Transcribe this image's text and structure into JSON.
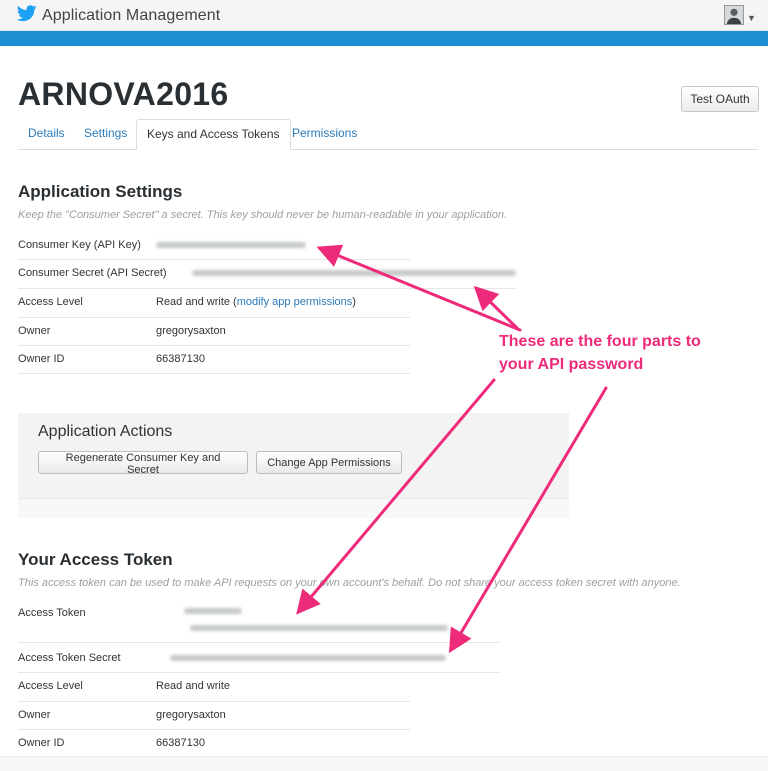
{
  "topbar": {
    "brand_title": "Application Management"
  },
  "header": {
    "app_name": "ARNOVA2016",
    "test_oauth_label": "Test OAuth"
  },
  "tabs": [
    {
      "label": "Details",
      "active": false
    },
    {
      "label": "Settings",
      "active": false
    },
    {
      "label": "Keys and Access Tokens",
      "active": true
    },
    {
      "label": "Permissions",
      "active": false
    }
  ],
  "application_settings": {
    "title": "Application Settings",
    "description": "Keep the \"Consumer Secret\" a secret. This key should never be human-readable in your application.",
    "rows": [
      {
        "label": "Consumer Key (API Key)",
        "value": ""
      },
      {
        "label": "Consumer Secret (API Secret)",
        "value": ""
      },
      {
        "label": "Access Level",
        "value": "Read and write (",
        "link": "modify app permissions",
        "suffix": ")"
      },
      {
        "label": "Owner",
        "value": "gregorysaxton"
      },
      {
        "label": "Owner ID",
        "value": "66387130"
      }
    ]
  },
  "application_actions": {
    "title": "Application Actions",
    "regenerate_label": "Regenerate Consumer Key and Secret",
    "change_permissions_label": "Change App Permissions"
  },
  "access_token": {
    "title": "Your Access Token",
    "description": "This access token can be used to make API requests on your own account's behalf. Do not share your access token secret with anyone.",
    "rows": [
      {
        "label": "Access Token",
        "value": ""
      },
      {
        "label": "Access Token Secret",
        "value": ""
      },
      {
        "label": "Access Level",
        "value": "Read and write"
      },
      {
        "label": "Owner",
        "value": "gregorysaxton"
      },
      {
        "label": "Owner ID",
        "value": "66387130"
      }
    ]
  },
  "annotation": {
    "line1": "These are the four parts to",
    "line2": "your API password",
    "color": "#ee2a7b"
  },
  "colors": {
    "accent_bar": "#1f8fd3",
    "link": "#2b7bb9",
    "twitter_bird": "#1da1f2"
  },
  "icons": {
    "brand": "twitter-bird-icon",
    "avatar": "user-avatar",
    "menu": "caret-down-icon"
  }
}
